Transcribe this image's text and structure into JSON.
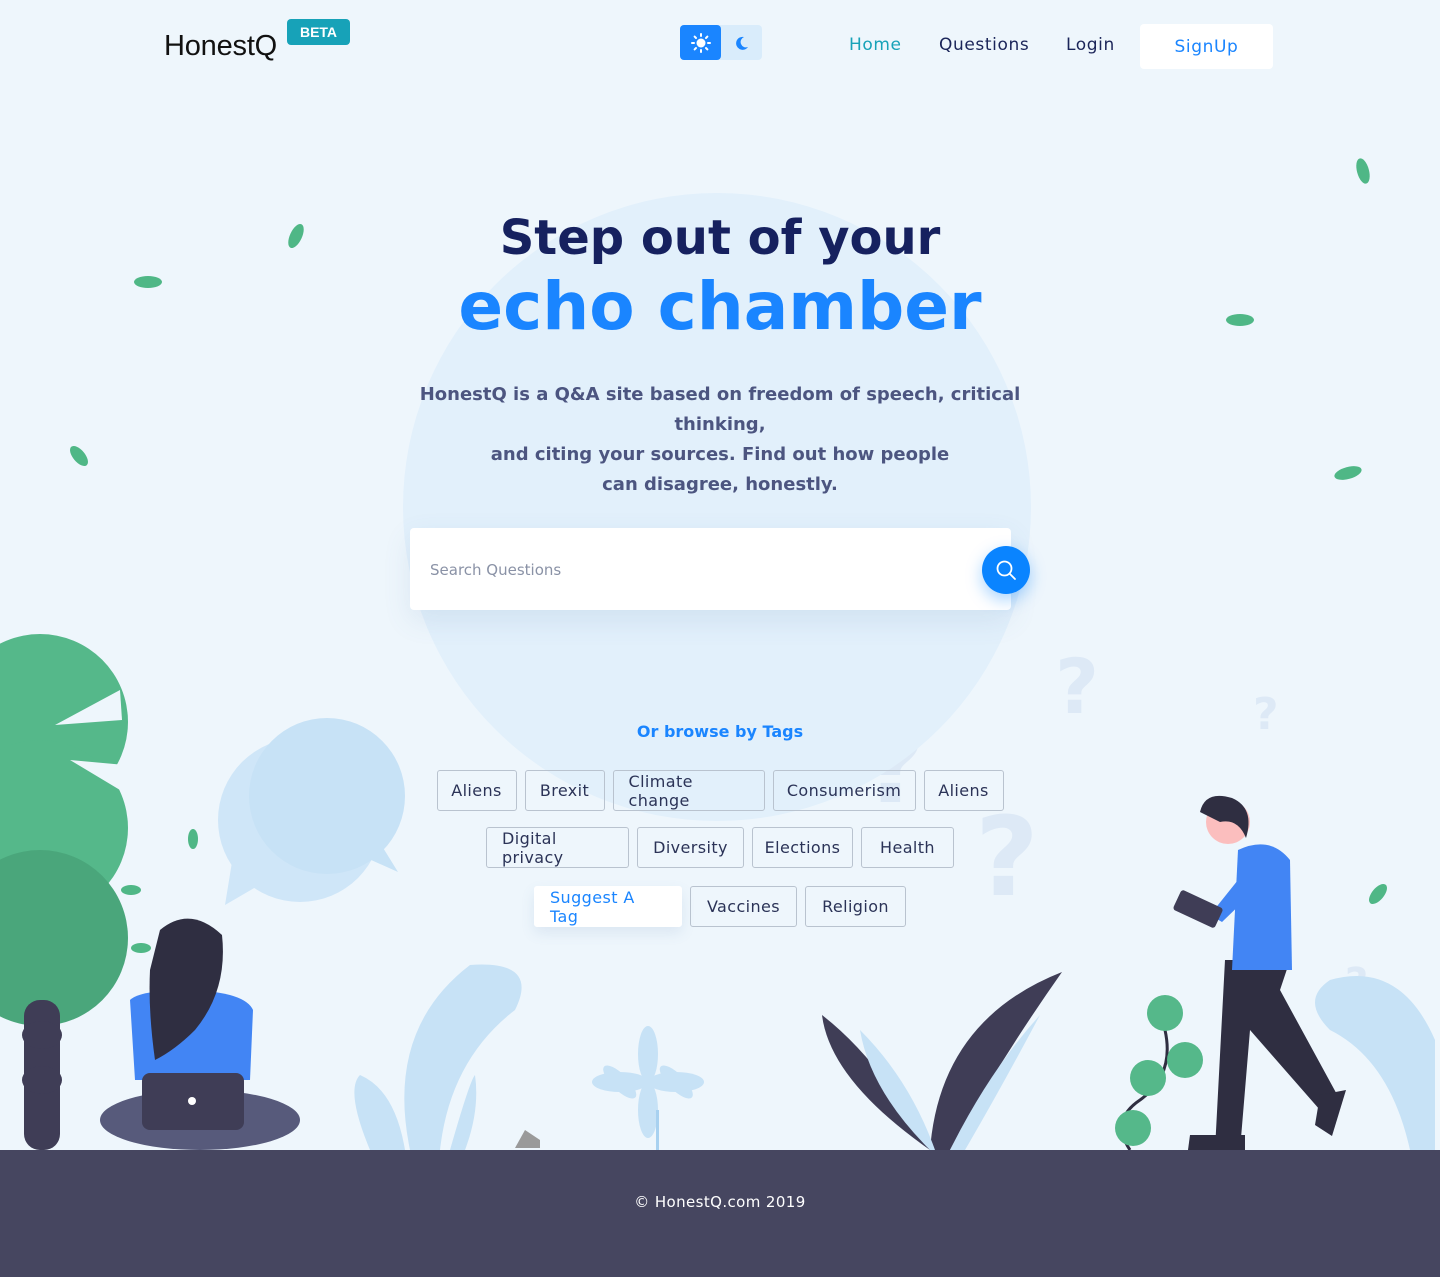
{
  "header": {
    "logo": "HonestQ",
    "badge": "BETA",
    "theme_toggle": {
      "light_icon": "sun-icon",
      "dark_icon": "moon-icon",
      "active": "light"
    },
    "nav": [
      {
        "label": "Home",
        "active": true
      },
      {
        "label": "Questions",
        "active": false
      },
      {
        "label": "Login",
        "active": false
      }
    ],
    "signup_label": "SignUp"
  },
  "hero": {
    "title_line1": "Step out of your",
    "title_line2": "echo chamber",
    "intro_lines": [
      "HonestQ is a Q&A site based on freedom of speech, critical thinking,",
      "and citing your sources. Find out how people",
      "can disagree, honestly."
    ]
  },
  "search": {
    "placeholder": "Search Questions",
    "button_icon": "search-icon"
  },
  "tags": {
    "label": "Or browse by Tags",
    "rows": [
      [
        "Aliens",
        "Brexit",
        "Climate change",
        "Consumerism",
        "Aliens"
      ],
      [
        "Digital privacy",
        "Diversity",
        "Elections",
        "Health"
      ],
      [
        "Vaccines",
        "Religion"
      ]
    ],
    "suggest_label": "Suggest A Tag"
  },
  "footer": {
    "copyright": "© HonestQ.com 2019"
  },
  "colors": {
    "accent": "#1a85ff",
    "teal": "#17a2b8",
    "navy": "#16215f",
    "footer": "#464660",
    "leaf_green": "#52b788",
    "background": "#eef6fc"
  }
}
